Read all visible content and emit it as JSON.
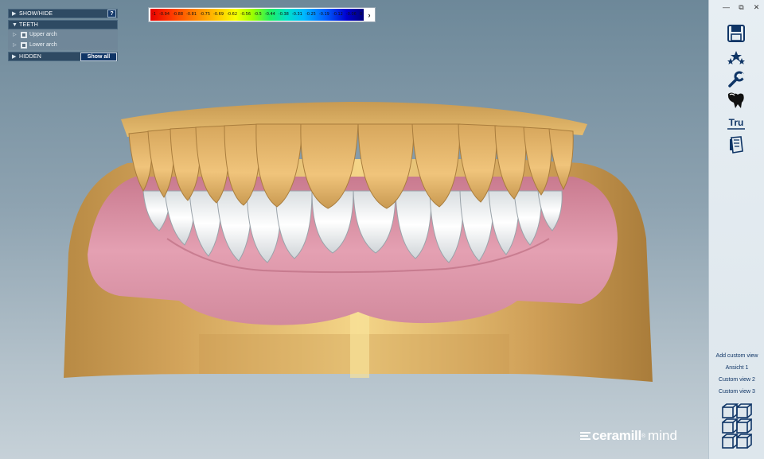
{
  "panel": {
    "show_hide": "SHOW/HIDE",
    "help": "?",
    "teeth": "TEETH",
    "items": [
      "Upper arch",
      "Lower arch"
    ],
    "hidden": "HIDDEN",
    "show_all": "Show all"
  },
  "scale": {
    "ticks": [
      "-1",
      "-0.94",
      "-0.88",
      "-0.81",
      "-0.75",
      "-0.69",
      "-0.62",
      "-0.56",
      "-0.5",
      "-0.44",
      "-0.38",
      "-0.31",
      "-0.25",
      "-0.19",
      "-0.12",
      "-0.06",
      "0"
    ]
  },
  "toolbar": {
    "minimize": "—",
    "restore": "⧉",
    "close": "✕",
    "icons": [
      "save-icon",
      "stars-icon",
      "wrench-icon",
      "tooth-icon",
      "tru-icon",
      "model-icon"
    ],
    "tru_label": "Tru",
    "views": [
      "Add custom view",
      "Ansicht 1",
      "Custom view 2",
      "Custom view 3"
    ]
  },
  "logo": {
    "brand": "ceramill",
    "reg": "®",
    "product": "mind"
  },
  "colors": {
    "accent": "#0f3566",
    "panel_head": "#2e4a63",
    "gold": "#d8a85a",
    "gum": "#d98a9e",
    "teeth_white": "#f2f2f2",
    "upper_teeth": "#e4b56c"
  }
}
